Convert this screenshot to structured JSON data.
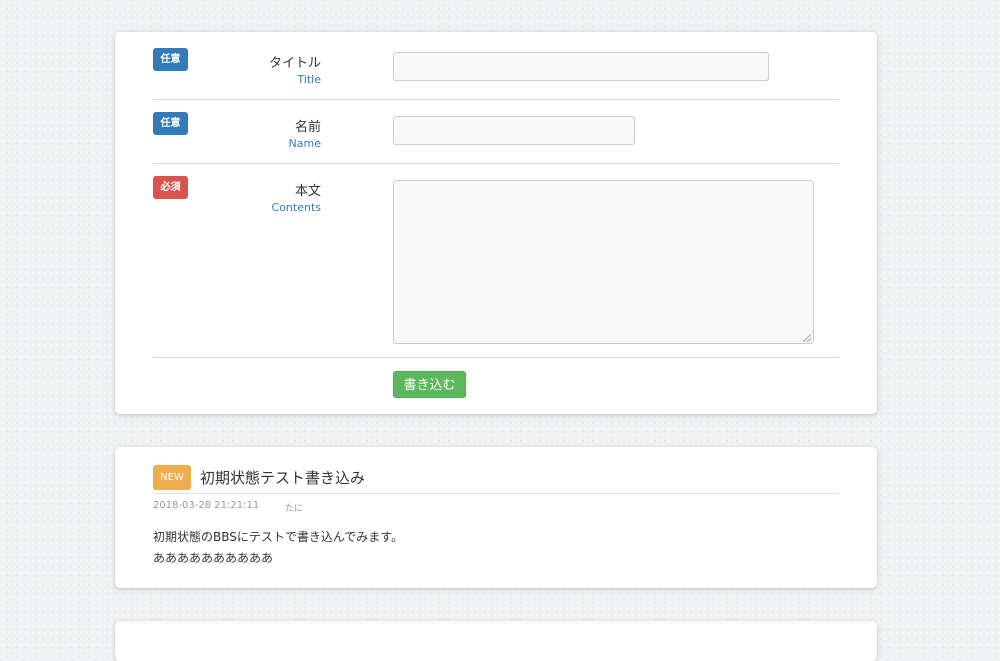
{
  "form": {
    "fields": [
      {
        "badge": "任意",
        "label_ja": "タイトル",
        "label_en": "Title",
        "value": ""
      },
      {
        "badge": "任意",
        "label_ja": "名前",
        "label_en": "Name",
        "value": ""
      },
      {
        "badge": "必須",
        "label_ja": "本文",
        "label_en": "Contents",
        "value": ""
      }
    ],
    "submit_label": "書き込む"
  },
  "colors": {
    "optional_badge": "#337ab7",
    "required_badge": "#d9534f",
    "submit": "#5cb85c",
    "new_badge": "#f0ad4e"
  },
  "posts": [
    {
      "badge": "NEW",
      "title": "初期状態テスト書き込み",
      "date": "2018-03-28 21:21:11",
      "author": "たに",
      "body_lines": [
        "初期状態のBBSにテストで書き込んでみます。",
        "ああああああああああ"
      ]
    }
  ]
}
